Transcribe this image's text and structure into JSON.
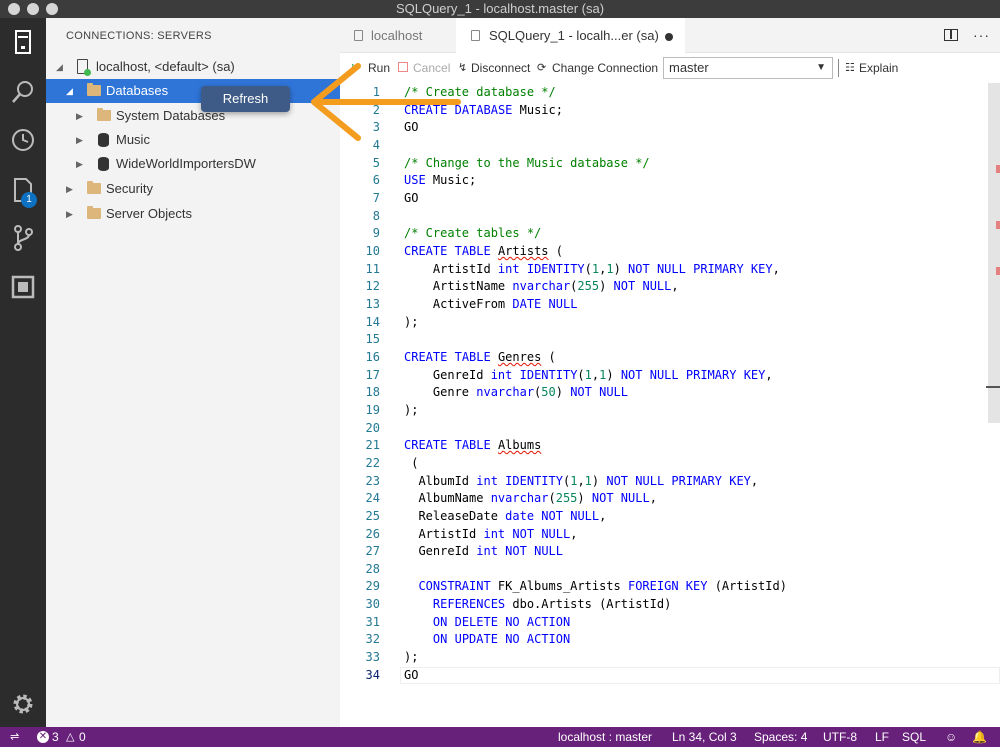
{
  "window": {
    "title": "SQLQuery_1 - localhost.master (sa)"
  },
  "sidebar": {
    "title": "CONNECTIONS: SERVERS",
    "tree": [
      {
        "label": "localhost, <default> (sa)",
        "type": "server"
      },
      {
        "label": "Databases",
        "type": "folder",
        "selected": true
      },
      {
        "label": "System Databases",
        "type": "folder"
      },
      {
        "label": "Music",
        "type": "database"
      },
      {
        "label": "WideWorldImportersDW",
        "type": "database"
      },
      {
        "label": "Security",
        "type": "folder"
      },
      {
        "label": "Server Objects",
        "type": "folder"
      }
    ],
    "context_popup": "Refresh"
  },
  "activity_bar": {
    "icons": [
      "servers-icon",
      "search-icon",
      "history-icon",
      "explorer-icon",
      "source-control-icon",
      "extensions-icon",
      "settings-icon"
    ],
    "badge": "1"
  },
  "tabs": [
    {
      "label": "localhost",
      "active": false
    },
    {
      "label": "SQLQuery_1 - localh...er (sa)",
      "active": true
    }
  ],
  "toolbar": {
    "run": "Run",
    "cancel": "Cancel",
    "disconnect": "Disconnect",
    "change_connection": "Change Connection",
    "database": "master",
    "explain": "Explain"
  },
  "editor": {
    "current_line": 34,
    "lines": [
      "/* Create database */",
      "CREATE DATABASE Music;",
      "GO",
      "",
      "/* Change to the Music database */",
      "USE Music;",
      "GO",
      "",
      "/* Create tables */",
      "CREATE TABLE Artists (",
      "    ArtistId int IDENTITY(1,1) NOT NULL PRIMARY KEY,",
      "    ArtistName nvarchar(255) NOT NULL,",
      "    ActiveFrom DATE NULL",
      ");",
      "",
      "CREATE TABLE Genres (",
      "    GenreId int IDENTITY(1,1) NOT NULL PRIMARY KEY,",
      "    Genre nvarchar(50) NOT NULL",
      ");",
      "",
      "CREATE TABLE Albums",
      " (",
      "  AlbumId int IDENTITY(1,1) NOT NULL PRIMARY KEY,",
      "  AlbumName nvarchar(255) NOT NULL,",
      "  ReleaseDate date NOT NULL,",
      "  ArtistId int NOT NULL,",
      "  GenreId int NOT NULL",
      "",
      "  CONSTRAINT FK_Albums_Artists FOREIGN KEY (ArtistId)",
      "    REFERENCES dbo.Artists (ArtistId)",
      "    ON DELETE NO ACTION",
      "    ON UPDATE NO ACTION",
      ");",
      "GO"
    ]
  },
  "statusbar": {
    "errors": "3",
    "warnings": "0",
    "connection": "localhost : master",
    "position": "Ln 34, Col 3",
    "spaces": "Spaces: 4",
    "encoding": "UTF-8",
    "eol": "LF",
    "language": "SQL"
  },
  "colors": {
    "statusbar": "#68217a",
    "selection": "#2f75d8",
    "arrow": "#f39c1e",
    "keyword": "#0000ff",
    "comment": "#008000"
  }
}
